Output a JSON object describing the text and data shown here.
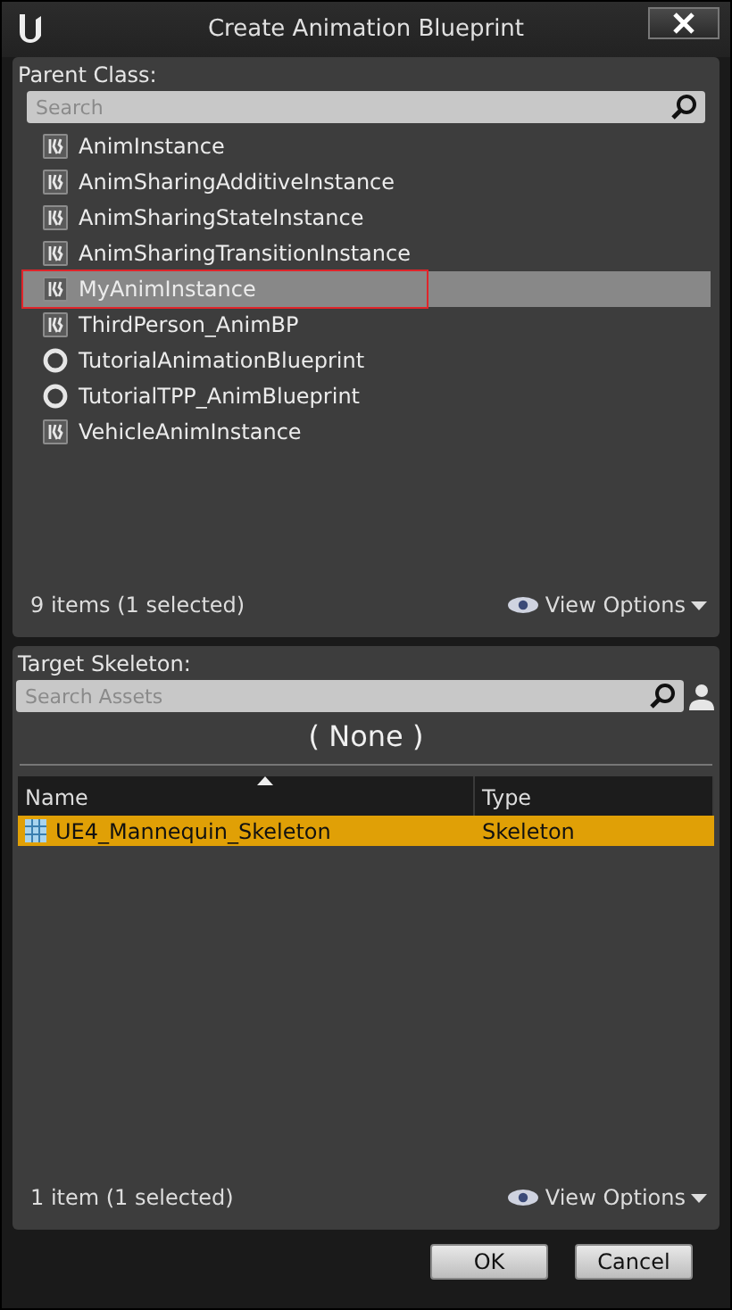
{
  "window": {
    "title": "Create Animation Blueprint"
  },
  "parent_class": {
    "label": "Parent Class:",
    "search": {
      "placeholder": "Search"
    },
    "items": [
      {
        "label": "AnimInstance",
        "kind": "anim",
        "selected": false,
        "outlined": false
      },
      {
        "label": "AnimSharingAdditiveInstance",
        "kind": "anim",
        "selected": false,
        "outlined": false
      },
      {
        "label": "AnimSharingStateInstance",
        "kind": "anim",
        "selected": false,
        "outlined": false
      },
      {
        "label": "AnimSharingTransitionInstance",
        "kind": "anim",
        "selected": false,
        "outlined": false
      },
      {
        "label": "MyAnimInstance",
        "kind": "anim",
        "selected": true,
        "outlined": true
      },
      {
        "label": "ThirdPerson_AnimBP",
        "kind": "anim",
        "selected": false,
        "outlined": false
      },
      {
        "label": "TutorialAnimationBlueprint",
        "kind": "blueprint",
        "selected": false,
        "outlined": false
      },
      {
        "label": "TutorialTPP_AnimBlueprint",
        "kind": "blueprint",
        "selected": false,
        "outlined": false
      },
      {
        "label": "VehicleAnimInstance",
        "kind": "anim",
        "selected": false,
        "outlined": false
      }
    ],
    "status": "9 items (1 selected)",
    "view_options": "View Options"
  },
  "target_skeleton": {
    "label": "Target Skeleton:",
    "search": {
      "placeholder": "Search Assets"
    },
    "current": "( None )",
    "columns": [
      "Name",
      "Type"
    ],
    "rows": [
      {
        "name": "UE4_Mannequin_Skeleton",
        "type": "Skeleton",
        "selected": true
      }
    ],
    "status": "1 item (1 selected)",
    "view_options": "View Options"
  },
  "buttons": [
    "OK",
    "Cancel"
  ]
}
